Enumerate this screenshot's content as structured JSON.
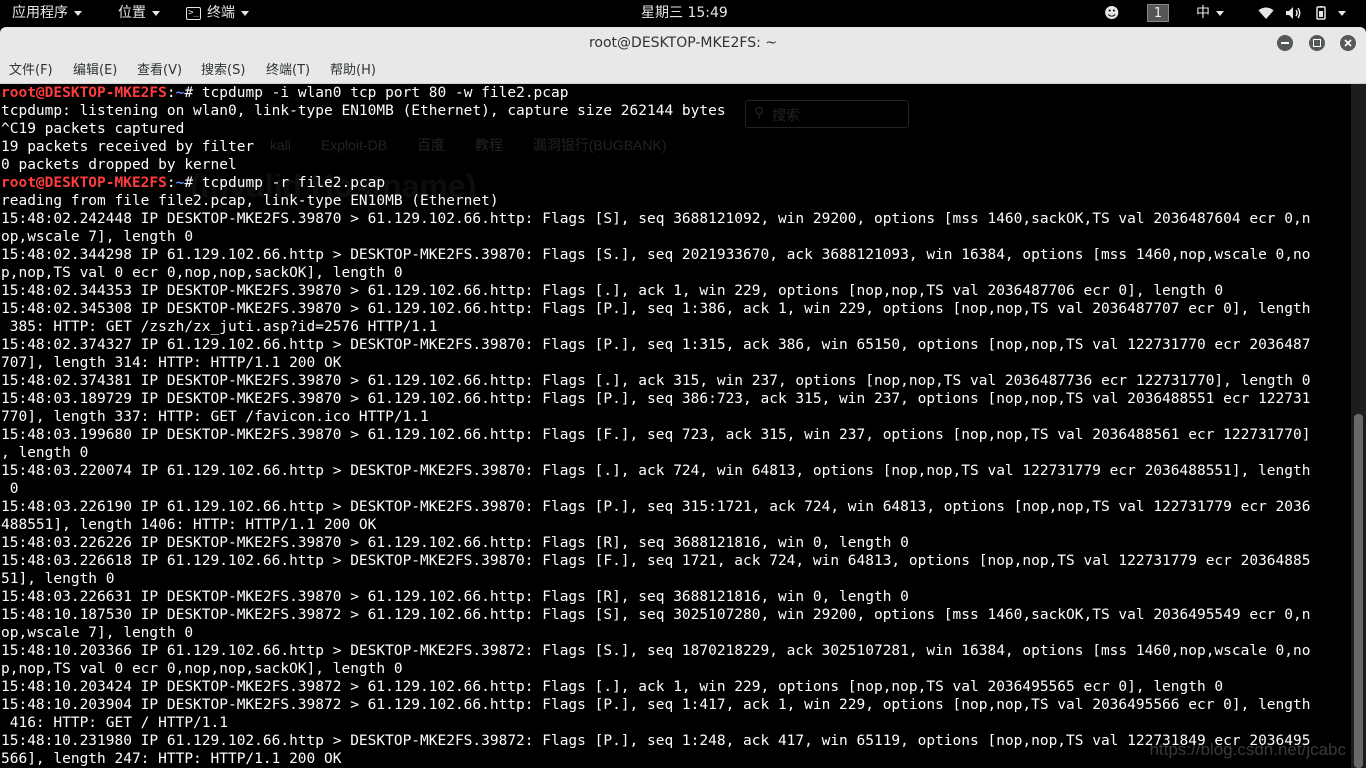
{
  "topbar": {
    "apps_label": "应用程序",
    "places_label": "位置",
    "terminal_label": "终端",
    "clock": "星期三 15:49",
    "workspace": "1",
    "input_method": "中"
  },
  "window": {
    "title": "root@DESKTOP-MKE2FS: ~"
  },
  "menubar": {
    "file": "文件(F)",
    "edit": "编辑(E)",
    "view": "查看(V)",
    "search": "搜索(S)",
    "terminal": "终端(T)",
    "help": "帮助(H)"
  },
  "background_browser": {
    "search_placeholder": "搜索",
    "bookmarks": [
      "kali",
      "Exploit-DB",
      "百度",
      "教程",
      "漏洞银行(BUGBANK)"
    ],
    "heading": "(Invalid Hostname)"
  },
  "terminal": {
    "prompt_user": "root@DESKTOP-MKE2FS",
    "prompt_path": "~",
    "prompt_symbol": "# ",
    "lines": [
      {
        "prompt": true,
        "text": "tcpdump -i wlan0 tcp port 80 -w file2.pcap"
      },
      {
        "text": "tcpdump: listening on wlan0, link-type EN10MB (Ethernet), capture size 262144 bytes"
      },
      {
        "text": "^C19 packets captured"
      },
      {
        "text": "19 packets received by filter"
      },
      {
        "text": "0 packets dropped by kernel"
      },
      {
        "prompt": true,
        "text": "tcpdump -r file2.pcap"
      },
      {
        "text": "reading from file file2.pcap, link-type EN10MB (Ethernet)"
      },
      {
        "text": "15:48:02.242448 IP DESKTOP-MKE2FS.39870 > 61.129.102.66.http: Flags [S], seq 3688121092, win 29200, options [mss 1460,sackOK,TS val 2036487604 ecr 0,n"
      },
      {
        "text": "op,wscale 7], length 0"
      },
      {
        "text": "15:48:02.344298 IP 61.129.102.66.http > DESKTOP-MKE2FS.39870: Flags [S.], seq 2021933670, ack 3688121093, win 16384, options [mss 1460,nop,wscale 0,no"
      },
      {
        "text": "p,nop,TS val 0 ecr 0,nop,nop,sackOK], length 0"
      },
      {
        "text": "15:48:02.344353 IP DESKTOP-MKE2FS.39870 > 61.129.102.66.http: Flags [.], ack 1, win 229, options [nop,nop,TS val 2036487706 ecr 0], length 0"
      },
      {
        "text": "15:48:02.345308 IP DESKTOP-MKE2FS.39870 > 61.129.102.66.http: Flags [P.], seq 1:386, ack 1, win 229, options [nop,nop,TS val 2036487707 ecr 0], length"
      },
      {
        "text": " 385: HTTP: GET /zszh/zx_juti.asp?id=2576 HTTP/1.1"
      },
      {
        "text": "15:48:02.374327 IP 61.129.102.66.http > DESKTOP-MKE2FS.39870: Flags [P.], seq 1:315, ack 386, win 65150, options [nop,nop,TS val 122731770 ecr 2036487"
      },
      {
        "text": "707], length 314: HTTP: HTTP/1.1 200 OK"
      },
      {
        "text": "15:48:02.374381 IP DESKTOP-MKE2FS.39870 > 61.129.102.66.http: Flags [.], ack 315, win 237, options [nop,nop,TS val 2036487736 ecr 122731770], length 0"
      },
      {
        "text": "15:48:03.189729 IP DESKTOP-MKE2FS.39870 > 61.129.102.66.http: Flags [P.], seq 386:723, ack 315, win 237, options [nop,nop,TS val 2036488551 ecr 122731"
      },
      {
        "text": "770], length 337: HTTP: GET /favicon.ico HTTP/1.1"
      },
      {
        "text": "15:48:03.199680 IP DESKTOP-MKE2FS.39870 > 61.129.102.66.http: Flags [F.], seq 723, ack 315, win 237, options [nop,nop,TS val 2036488561 ecr 122731770]"
      },
      {
        "text": ", length 0"
      },
      {
        "text": "15:48:03.220074 IP 61.129.102.66.http > DESKTOP-MKE2FS.39870: Flags [.], ack 724, win 64813, options [nop,nop,TS val 122731779 ecr 2036488551], length"
      },
      {
        "text": " 0"
      },
      {
        "text": "15:48:03.226190 IP 61.129.102.66.http > DESKTOP-MKE2FS.39870: Flags [P.], seq 315:1721, ack 724, win 64813, options [nop,nop,TS val 122731779 ecr 2036"
      },
      {
        "text": "488551], length 1406: HTTP: HTTP/1.1 200 OK"
      },
      {
        "text": "15:48:03.226226 IP DESKTOP-MKE2FS.39870 > 61.129.102.66.http: Flags [R], seq 3688121816, win 0, length 0"
      },
      {
        "text": "15:48:03.226618 IP 61.129.102.66.http > DESKTOP-MKE2FS.39870: Flags [F.], seq 1721, ack 724, win 64813, options [nop,nop,TS val 122731779 ecr 20364885"
      },
      {
        "text": "51], length 0"
      },
      {
        "text": "15:48:03.226631 IP DESKTOP-MKE2FS.39870 > 61.129.102.66.http: Flags [R], seq 3688121816, win 0, length 0"
      },
      {
        "text": "15:48:10.187530 IP DESKTOP-MKE2FS.39872 > 61.129.102.66.http: Flags [S], seq 3025107280, win 29200, options [mss 1460,sackOK,TS val 2036495549 ecr 0,n"
      },
      {
        "text": "op,wscale 7], length 0"
      },
      {
        "text": "15:48:10.203366 IP 61.129.102.66.http > DESKTOP-MKE2FS.39872: Flags [S.], seq 1870218229, ack 3025107281, win 16384, options [mss 1460,nop,wscale 0,no"
      },
      {
        "text": "p,nop,TS val 0 ecr 0,nop,nop,sackOK], length 0"
      },
      {
        "text": "15:48:10.203424 IP DESKTOP-MKE2FS.39872 > 61.129.102.66.http: Flags [.], ack 1, win 229, options [nop,nop,TS val 2036495565 ecr 0], length 0"
      },
      {
        "text": "15:48:10.203904 IP DESKTOP-MKE2FS.39872 > 61.129.102.66.http: Flags [P.], seq 1:417, ack 1, win 229, options [nop,nop,TS val 2036495566 ecr 0], length"
      },
      {
        "text": " 416: HTTP: GET / HTTP/1.1"
      },
      {
        "text": "15:48:10.231980 IP 61.129.102.66.http > DESKTOP-MKE2FS.39872: Flags [P.], seq 1:248, ack 417, win 65119, options [nop,nop,TS val 122731849 ecr 2036495"
      },
      {
        "text": "566], length 247: HTTP: HTTP/1.1 200 OK"
      }
    ]
  },
  "watermark": "https://blog.csdn.net/jcabc"
}
